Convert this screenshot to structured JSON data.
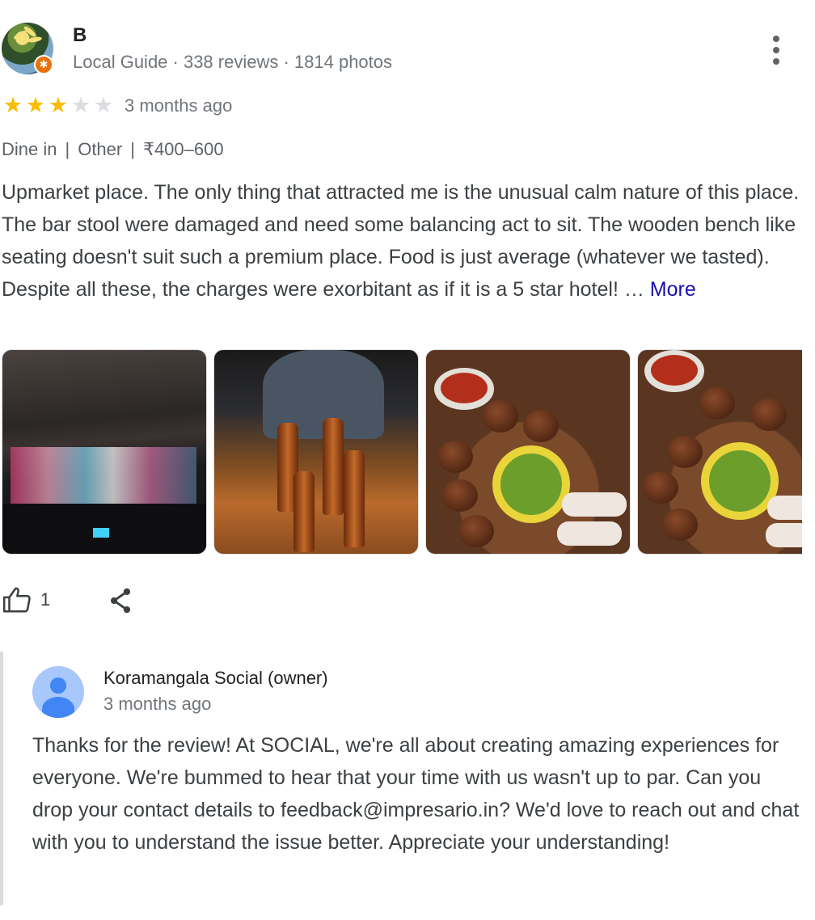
{
  "review": {
    "author": {
      "name": "B",
      "meta": "Local Guide · 338 reviews · 1814 photos",
      "avatar_icon": "profile-photo",
      "badge_icon": "local-guide-star-badge"
    },
    "more_menu_icon": "more-vert-icon",
    "rating": {
      "value": 3,
      "max": 5,
      "star_color": "#fbbc04",
      "empty_star_color": "#dadce0"
    },
    "time": "3 months ago",
    "tags": [
      "Dine in",
      "Other",
      "₹400–600"
    ],
    "tag_separator": "|",
    "text": "Upmarket place. The only thing that attracted me is the unusual calm nature of this place. The bar stool were damaged and need some balancing act to sit. The wooden bench like seating doesn't suit such a premium place. Food is just average (whatever we tasted). Despite all these, the charges were exorbitant as if it is a 5 star hotel! …",
    "more_label": "More",
    "link_color": "#1a0dab",
    "photos": [
      {
        "subject": "bar-interior-photo"
      },
      {
        "subject": "beer-bottles-photo"
      },
      {
        "subject": "momo-platter-photo"
      },
      {
        "subject": "momo-platter-photo"
      }
    ],
    "actions": {
      "like_count": "1",
      "like_icon": "thumb-up-icon",
      "share_icon": "share-icon"
    }
  },
  "owner_reply": {
    "name": "Koramangala Social (owner)",
    "time": "3 months ago",
    "avatar_icon": "default-person-icon",
    "text": "Thanks for the review! At SOCIAL, we're all about creating amazing experiences for everyone. We're bummed to hear that your time with us wasn't up to par. Can you drop your contact details to feedback@impresario.in? We'd love to reach out and chat with you to understand the issue better. Appreciate your understanding!"
  }
}
